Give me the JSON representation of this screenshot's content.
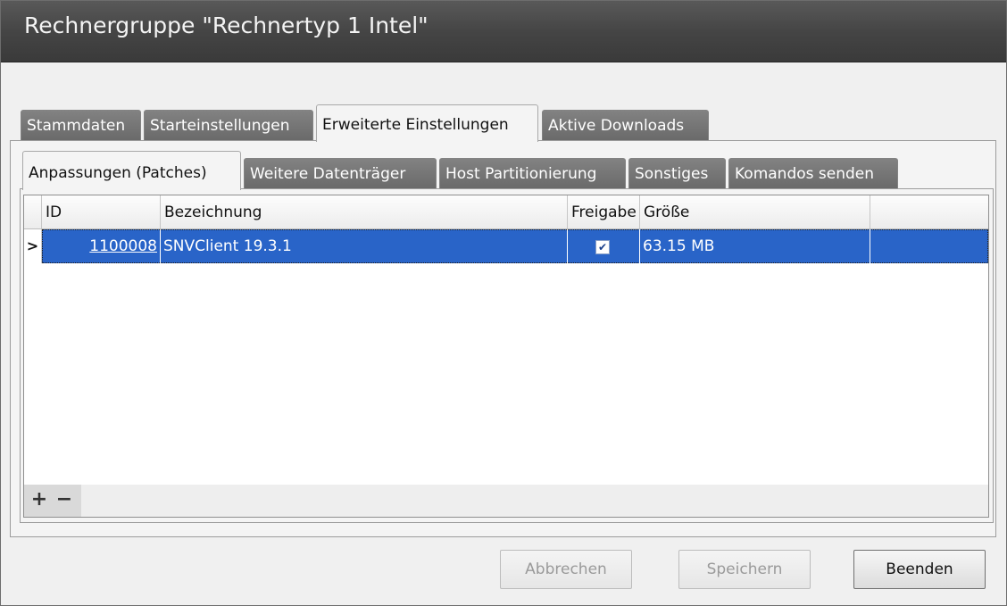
{
  "window": {
    "title": "Rechnergruppe \"Rechnertyp 1 Intel\""
  },
  "main_tabs": [
    {
      "label": "Stammdaten",
      "active": false
    },
    {
      "label": "Starteinstellungen",
      "active": false
    },
    {
      "label": "Erweiterte Einstellungen",
      "active": true
    },
    {
      "label": "Aktive Downloads",
      "active": false
    }
  ],
  "sub_tabs": [
    {
      "label": "Anpassungen (Patches)",
      "active": true
    },
    {
      "label": "Weitere Datenträger",
      "active": false
    },
    {
      "label": "Host Partitionierung",
      "active": false
    },
    {
      "label": "Sonstiges",
      "active": false
    },
    {
      "label": "Komandos senden",
      "active": false
    }
  ],
  "grid": {
    "columns": [
      "ID",
      "Bezeichnung",
      "Freigabe",
      "Größe"
    ],
    "rows": [
      {
        "id": "1100008",
        "bezeichnung": "SNVClient 19.3.1",
        "freigabe": true,
        "groesse": "63.15 MB",
        "selected": true
      }
    ],
    "row_indicator": ">",
    "add_icon": "plus-icon",
    "remove_icon": "minus-icon"
  },
  "buttons": {
    "abbrechen": "Abbrechen",
    "speichern": "Speichern",
    "beenden": "Beenden"
  },
  "colors": {
    "selection": "#2964c8",
    "titlebar": "#454545",
    "tab_inactive": "#747474"
  }
}
